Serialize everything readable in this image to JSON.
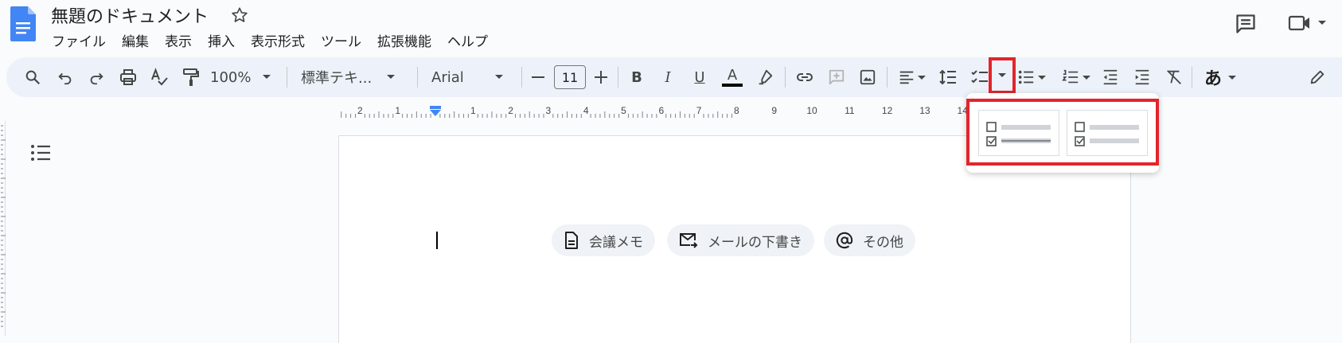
{
  "document": {
    "title": "無題のドキュメント"
  },
  "menu": [
    "ファイル",
    "編集",
    "表示",
    "挿入",
    "表示形式",
    "ツール",
    "拡張機能",
    "ヘルプ"
  ],
  "toolbar": {
    "zoom": "100%",
    "style": "標準テキ...",
    "font": "Arial",
    "font_size": "11",
    "bold": "B",
    "italic": "I",
    "underline": "U",
    "text_color": "A",
    "input_tools": "あ"
  },
  "ruler": {
    "ticks": [
      "2",
      "1",
      "1",
      "2",
      "3",
      "4",
      "5",
      "6",
      "7",
      "8",
      "9",
      "10",
      "11",
      "12",
      "13",
      "14"
    ]
  },
  "smart_chips": [
    {
      "label": "会議メモ",
      "icon": "document-icon"
    },
    {
      "label": "メールの下書き",
      "icon": "email-forward-icon"
    },
    {
      "label": "その他",
      "icon": "at-sign-icon"
    }
  ],
  "checklist_popup": {
    "options": [
      "checklist-strikethrough",
      "checklist-plain"
    ]
  },
  "colors": {
    "highlight": "#e3242b",
    "docs_blue": "#4285f4",
    "toolbar_bg": "#edf2fa"
  }
}
